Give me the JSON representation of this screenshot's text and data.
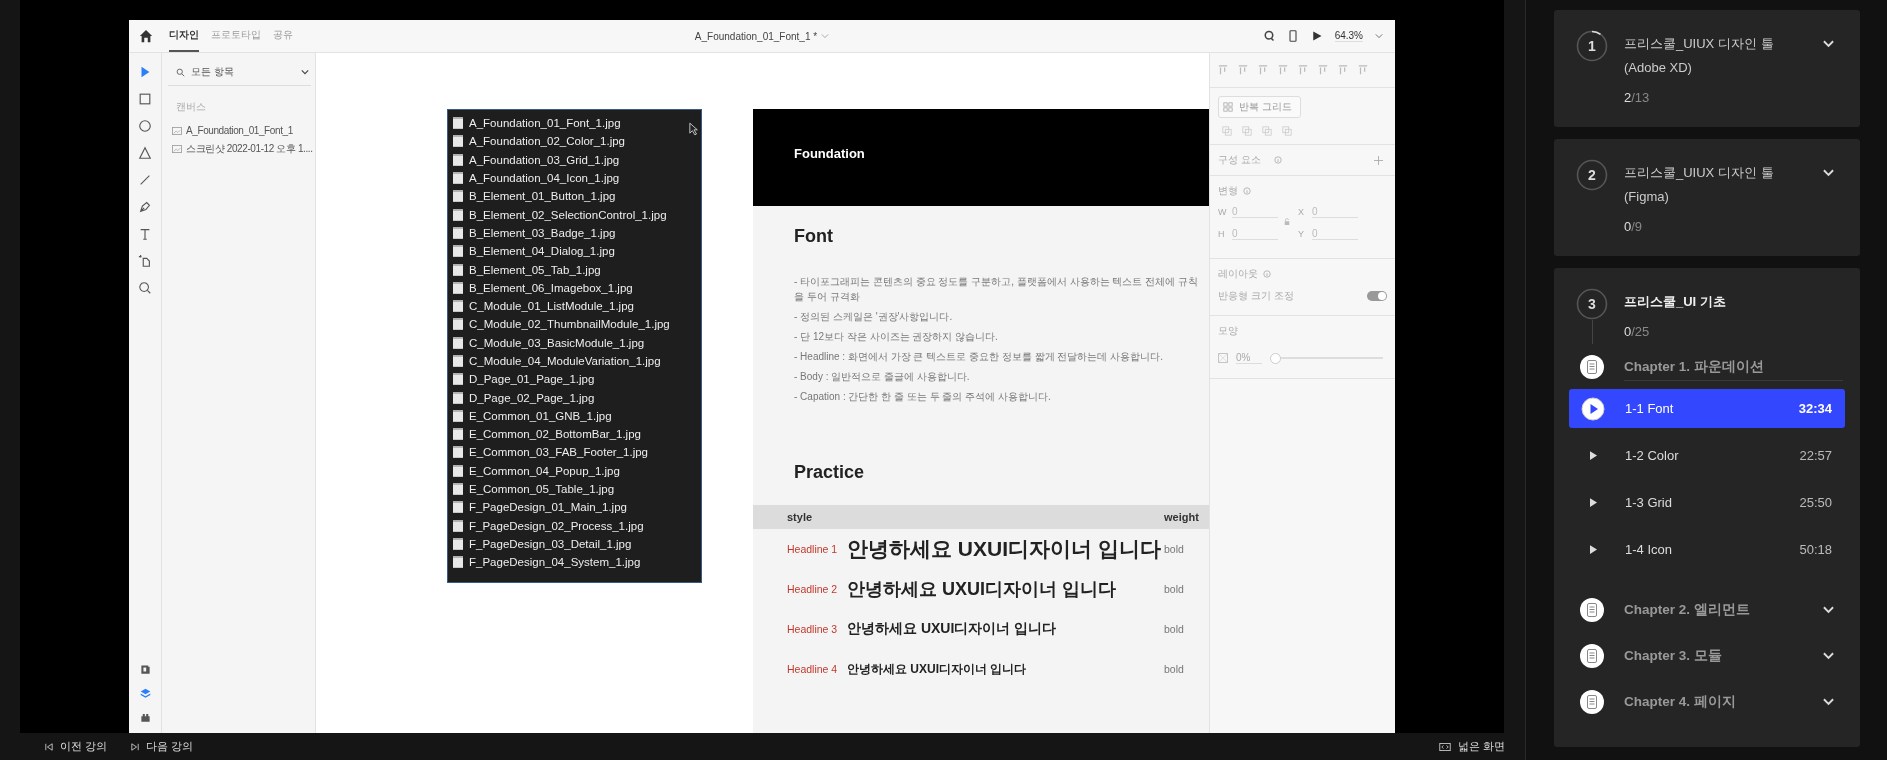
{
  "player": {
    "xd": {
      "tabs": [
        {
          "label": "디자인",
          "selected": true
        },
        {
          "label": "프로토타입",
          "selected": false
        },
        {
          "label": "공유",
          "selected": false
        }
      ],
      "document_title": "A_Foundation_01_Font_1 *",
      "zoom": "64.3%",
      "tools": [
        {
          "kind": "select",
          "selected": true
        },
        {
          "kind": "rectangle",
          "selected": false
        },
        {
          "kind": "ellipse",
          "selected": false
        },
        {
          "kind": "polygon",
          "selected": false
        },
        {
          "kind": "line",
          "selected": false
        },
        {
          "kind": "pen",
          "selected": false
        },
        {
          "kind": "text",
          "selected": false
        },
        {
          "kind": "artboard",
          "selected": false
        },
        {
          "kind": "zoom",
          "selected": false
        }
      ],
      "panel_tools": [
        {
          "kind": "assets",
          "selected": false
        },
        {
          "kind": "layers",
          "selected": true
        },
        {
          "kind": "plugins",
          "selected": false
        }
      ],
      "layers": {
        "filter": "모든 항목",
        "section": "캔버스",
        "items": [
          "A_Foundation_01_Font_1",
          "스크린샷 2022-01-12 오후 1...."
        ]
      },
      "file_list": [
        "A_Foundation_01_Font_1.jpg",
        "A_Foundation_02_Color_1.jpg",
        "A_Foundation_03_Grid_1.jpg",
        "A_Foundation_04_Icon_1.jpg",
        "B_Element_01_Button_1.jpg",
        "B_Element_02_SelectionControl_1.jpg",
        "B_Element_03_Badge_1.jpg",
        "B_Element_04_Dialog_1.jpg",
        "B_Element_05_Tab_1.jpg",
        "B_Element_06_Imagebox_1.jpg",
        "C_Module_01_ListModule_1.jpg",
        "C_Module_02_ThumbnailModule_1.jpg",
        "C_Module_03_BasicModule_1.jpg",
        "C_Module_04_ModuleVariation_1.jpg",
        "D_Page_01_Page_1.jpg",
        "D_Page_02_Page_1.jpg",
        "E_Common_01_GNB_1.jpg",
        "E_Common_02_BottomBar_1.jpg",
        "E_Common_03_FAB_Footer_1.jpg",
        "E_Common_04_Popup_1.jpg",
        "E_Common_05_Table_1.jpg",
        "F_PageDesign_01_Main_1.jpg",
        "F_PageDesign_02_Process_1.jpg",
        "F_PageDesign_03_Detail_1.jpg",
        "F_PageDesign_04_System_1.jpg"
      ],
      "artboard": {
        "header": "Foundation",
        "font_title": "Font",
        "notes": [
          "- 타이포그래피는 콘텐츠의 중요 정도를 구분하고, 플랫폼에서 사용하는 텍스트 전체에 규칙을 두어 규격화",
          "- 정의된 스케일은 '권장'사항입니다.",
          "- 단 12보다 작은 사이즈는 권장하지 않습니다.",
          "- Headline : 화면에서 가장 큰 텍스트로 중요한 정보를 짧게 전달하는데 사용합니다.",
          "- Body : 일반적으로 줄글에 사용합니다.",
          "- Capation : 간단한 한 줄 또는 두 줄의 주석에 사용합니다."
        ],
        "practice_title": "Practice",
        "table": {
          "columns": [
            "style",
            "weight"
          ],
          "rows": [
            {
              "style": "Headline 1",
              "sample": "안녕하세요 UXUI디자이너 입니다",
              "weight": "bold",
              "kind": "h1"
            },
            {
              "style": "Headline 2",
              "sample": "안녕하세요 UXUI디자이너 입니다",
              "weight": "bold",
              "kind": "h2"
            },
            {
              "style": "Headline 3",
              "sample": "안녕하세요 UXUI디자이너 입니다",
              "weight": "bold",
              "kind": "h3"
            },
            {
              "style": "Headline 4",
              "sample": "안녕하세요 UXUI디자이너 입니다",
              "weight": "bold",
              "kind": "h4"
            }
          ]
        }
      },
      "properties": {
        "repeat_grid": "반복 그리드",
        "components": "구성 요소",
        "transform": "변형",
        "fields": [
          {
            "label": "W",
            "value": "0"
          },
          {
            "label": "X",
            "value": "0"
          },
          {
            "label": "H",
            "value": "0"
          },
          {
            "label": "Y",
            "value": "0"
          }
        ],
        "layout": "레이아웃",
        "responsive": {
          "label": "반응형 크기 조정",
          "on": true
        },
        "appearance": "모양",
        "opacity": {
          "value": "0%",
          "level": 0
        }
      }
    },
    "nav": {
      "prev": "이전 강의",
      "next": "다음 강의",
      "wide": "넓은 화면"
    }
  },
  "curriculum": [
    {
      "number": "1",
      "title": "프리스쿨_UIUX 디자인 툴 (Adobe XD)",
      "done": "2",
      "total": "/13",
      "in_progress": true,
      "current": false,
      "expanded": false
    },
    {
      "number": "2",
      "title": "프리스쿨_UIUX 디자인 툴 (Figma)",
      "done": "0",
      "total": "/9",
      "in_progress": false,
      "current": false,
      "expanded": false
    },
    {
      "number": "3",
      "title": "프리스쿨_UI 기초",
      "done": "0",
      "total": "/25",
      "in_progress": false,
      "current": true,
      "expanded": true,
      "chapters": [
        {
          "title": "Chapter 1. 파운데이션",
          "expanded": true,
          "lectures": [
            {
              "title": "1-1 Font",
              "duration": "32:34",
              "selected": true
            },
            {
              "title": "1-2 Color",
              "duration": "22:57",
              "selected": false
            },
            {
              "title": "1-3 Grid",
              "duration": "25:50",
              "selected": false
            },
            {
              "title": "1-4 Icon",
              "duration": "50:18",
              "selected": false
            }
          ]
        },
        {
          "title": "Chapter 2. 엘리먼트",
          "expanded": false
        },
        {
          "title": "Chapter 3. 모듈",
          "expanded": false
        },
        {
          "title": "Chapter 4. 페이지",
          "expanded": false
        }
      ]
    }
  ]
}
